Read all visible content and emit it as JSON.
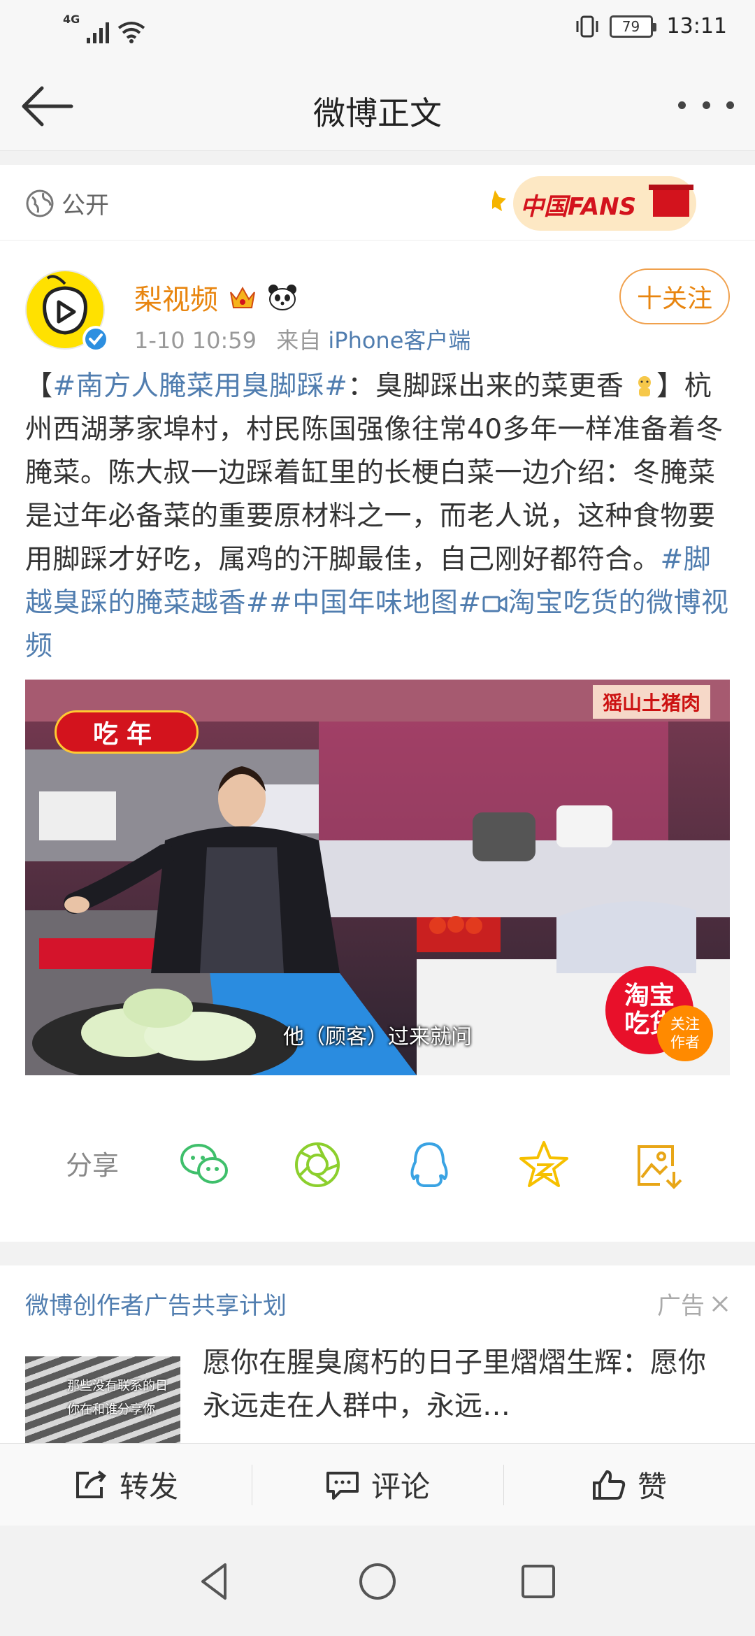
{
  "status_bar": {
    "network": "4G",
    "battery": "79",
    "time": "13:11"
  },
  "header": {
    "title": "微博正文"
  },
  "visibility": {
    "label": "公开",
    "badge_text": "中国FANS"
  },
  "post": {
    "author": "梨视频",
    "date": "1-10 10:59",
    "source_prefix": "来自",
    "source": "iPhone客户端",
    "follow_label": "十关注",
    "text": {
      "open_bracket": "【",
      "topic1": "#南方人腌菜用臭脚踩#",
      "lead": "：臭脚踩出来的菜更香",
      "body": "】杭州西湖茅家埠村，村民陈国强像往常40多年一样准备着冬腌菜。陈大叔一边踩着缸里的长梗白菜一边介绍：冬腌菜是过年必备菜的重要原材料之一，而老人说，这种食物要用脚踩才好吃，属鸡的汗脚最佳，自己刚好都符合。",
      "topic2": "#脚越臭踩的腌菜越香#",
      "topic3": "#中国年味地图#",
      "video_link": "淘宝吃货的微博视频"
    },
    "video": {
      "overlay_tag": "吃年",
      "stall_sign": "猺山土猪肉",
      "subtitle": "他（顾客）过来就问",
      "channel_badge": "淘宝吃货",
      "channel_follow": "关注作者"
    },
    "share": {
      "label": "分享",
      "targets": [
        "wechat-icon",
        "moments-icon",
        "qq-icon",
        "qzone-icon",
        "save-image-icon"
      ]
    }
  },
  "ad": {
    "title": "微博创作者广告共享计划",
    "tag": "广告",
    "thumb_caption_1": "那些没有联系的日",
    "thumb_caption_2": "你在和谁分享你",
    "text": "愿你在腥臭腐朽的日子里熠熠生辉：愿你永远走在人群中，永远…"
  },
  "actions": {
    "repost": "转发",
    "comment": "评论",
    "like": "赞"
  },
  "colors": {
    "link": "#507daf",
    "author": "#e8850f",
    "accent_red": "#e8102a"
  }
}
